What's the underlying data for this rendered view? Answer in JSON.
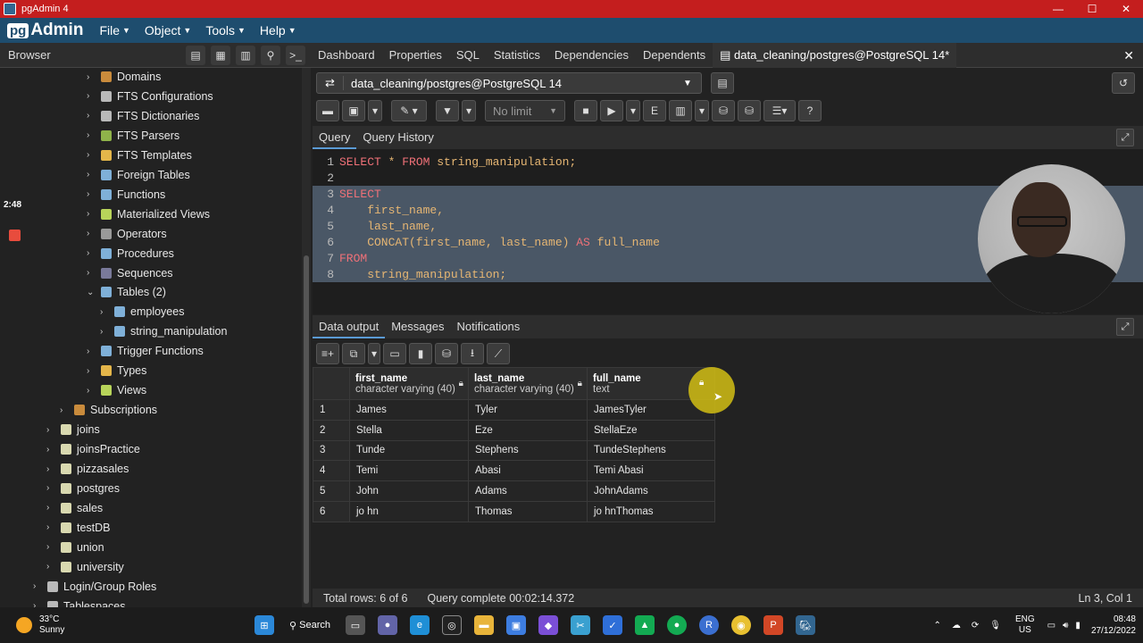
{
  "window": {
    "title": "pgAdmin 4",
    "controls": [
      "—",
      "☐",
      "✕"
    ]
  },
  "menubar": {
    "logo_pg": "pg",
    "logo_rest": "Admin",
    "items": [
      "File",
      "Object",
      "Tools",
      "Help"
    ]
  },
  "browser": {
    "title": "Browser"
  },
  "tree": [
    {
      "label": "Domains",
      "color": "#c98b3c"
    },
    {
      "label": "FTS Configurations",
      "color": "#b9b9b9"
    },
    {
      "label": "FTS Dictionaries",
      "color": "#b9b9b9"
    },
    {
      "label": "FTS Parsers",
      "color": "#8fb34a"
    },
    {
      "label": "FTS Templates",
      "color": "#e4b64a"
    },
    {
      "label": "Foreign Tables",
      "color": "#7fb0d8"
    },
    {
      "label": "Functions",
      "color": "#7fb0d8"
    },
    {
      "label": "Materialized Views",
      "color": "#b8d45a"
    },
    {
      "label": "Operators",
      "color": "#999999"
    },
    {
      "label": "Procedures",
      "color": "#7fb0d8"
    },
    {
      "label": "Sequences",
      "color": "#7a7a9a"
    },
    {
      "label": "Tables (2)",
      "color": "#7fb0d8"
    },
    {
      "label": "employees",
      "color": "#7fb0d8"
    },
    {
      "label": "string_manipulation",
      "color": "#7fb0d8"
    },
    {
      "label": "Trigger Functions",
      "color": "#7fb0d8"
    },
    {
      "label": "Types",
      "color": "#e4b64a"
    },
    {
      "label": "Views",
      "color": "#b8d45a"
    },
    {
      "label": "Subscriptions",
      "color": "#c98b3c"
    },
    {
      "label": "joins",
      "color": "#d9d9b0"
    },
    {
      "label": "joinsPractice",
      "color": "#d9d9b0"
    },
    {
      "label": "pizzasales",
      "color": "#d9d9b0"
    },
    {
      "label": "postgres",
      "color": "#d9d9b0"
    },
    {
      "label": "sales",
      "color": "#d9d9b0"
    },
    {
      "label": "testDB",
      "color": "#d9d9b0"
    },
    {
      "label": "union",
      "color": "#d9d9b0"
    },
    {
      "label": "university",
      "color": "#d9d9b0"
    },
    {
      "label": "Login/Group Roles",
      "color": "#b9b9b9"
    },
    {
      "label": "Tablespaces",
      "color": "#b9b9b9"
    }
  ],
  "side_time": "2:48",
  "tabs": [
    "Dashboard",
    "Properties",
    "SQL",
    "Statistics",
    "Dependencies",
    "Dependents",
    "data_cleaning/postgres@PostgreSQL 14*"
  ],
  "connection": "data_cleaning/postgres@PostgreSQL 14",
  "limit": "No limit",
  "query_tabs": [
    "Query",
    "Query History"
  ],
  "code": [
    {
      "n": "1",
      "parts": [
        [
          "kw",
          "SELECT"
        ],
        [
          "id",
          " * "
        ],
        [
          "kw",
          "FROM"
        ],
        [
          "id",
          " string_manipulation;"
        ]
      ],
      "sel": false
    },
    {
      "n": "2",
      "parts": [],
      "sel": false
    },
    {
      "n": "3",
      "parts": [
        [
          "kw",
          "SELECT"
        ]
      ],
      "sel": true
    },
    {
      "n": "4",
      "parts": [
        [
          "id",
          "    first_name,"
        ]
      ],
      "sel": true
    },
    {
      "n": "5",
      "parts": [
        [
          "id",
          "    last_name,"
        ]
      ],
      "sel": true
    },
    {
      "n": "6",
      "parts": [
        [
          "id",
          "    CONCAT(first_name, last_name) "
        ],
        [
          "kw",
          "AS"
        ],
        [
          "id",
          " full_name"
        ]
      ],
      "sel": true
    },
    {
      "n": "7",
      "parts": [
        [
          "kw",
          "FROM"
        ]
      ],
      "sel": true
    },
    {
      "n": "8",
      "parts": [
        [
          "id",
          "    string_manipulation;"
        ]
      ],
      "sel": true
    }
  ],
  "output_tabs": [
    "Data output",
    "Messages",
    "Notifications"
  ],
  "grid": {
    "columns": [
      {
        "name": "first_name",
        "type": "character varying (40)",
        "locked": true
      },
      {
        "name": "last_name",
        "type": "character varying (40)",
        "locked": true
      },
      {
        "name": "full_name",
        "type": "text",
        "locked": true
      }
    ],
    "rows": [
      [
        "1",
        "James",
        "Tyler",
        "JamesTyler"
      ],
      [
        "2",
        "Stella",
        "Eze",
        "StellaEze"
      ],
      [
        "3",
        "Tunde",
        "Stephens",
        "TundeStephens"
      ],
      [
        "4",
        "Temi",
        "Abasi",
        "Temi Abasi"
      ],
      [
        "5",
        "John",
        "Adams",
        "JohnAdams"
      ],
      [
        "6",
        "jo hn",
        "Thomas",
        "jo hnThomas"
      ]
    ]
  },
  "status": {
    "rows": "Total rows: 6 of 6",
    "query": "Query complete 00:02:14.372",
    "cursor": "Ln 3, Col 1"
  },
  "taskbar": {
    "temp": "33°C",
    "weather": "Sunny",
    "search": "Search",
    "lang1": "ENG",
    "lang2": "US",
    "time": "08:48",
    "date": "27/12/2022"
  }
}
